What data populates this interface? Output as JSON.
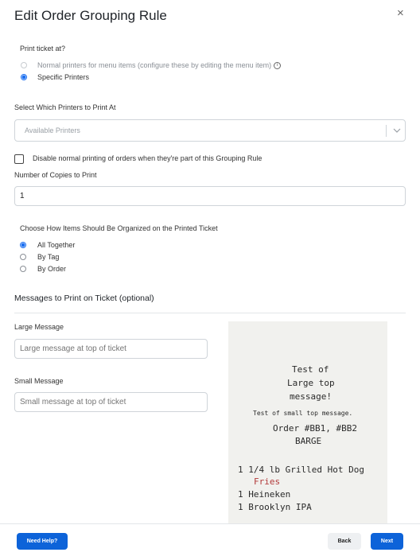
{
  "dialog": {
    "title": "Edit Order Grouping Rule",
    "close_glyph": "×"
  },
  "print_at": {
    "label": "Print ticket at?",
    "options": [
      {
        "label": "Normal printers for menu items (configure these by editing the menu item)",
        "selected": false,
        "disabled": true
      },
      {
        "label": "Specific Printers",
        "selected": true,
        "disabled": false
      }
    ],
    "info_glyph": "i"
  },
  "printers": {
    "label": "Select Which Printers to Print At",
    "placeholder": "Available Printers"
  },
  "disable_normal": {
    "label": "Disable normal printing of orders when they're part of this Grouping Rule",
    "checked": false
  },
  "copies": {
    "label": "Number of Copies to Print",
    "value": "1"
  },
  "organize": {
    "label": "Choose How Items Should Be Organized on the Printed Ticket",
    "options": [
      {
        "label": "All Together",
        "selected": true
      },
      {
        "label": "By Tag",
        "selected": false
      },
      {
        "label": "By Order",
        "selected": false
      }
    ]
  },
  "messages": {
    "title": "Messages to Print on Ticket (optional)",
    "large": {
      "label": "Large Message",
      "placeholder": "Large message at top of ticket"
    },
    "small": {
      "label": "Small Message",
      "placeholder": "Small message at top of ticket"
    }
  },
  "receipt": {
    "large_lines": [
      "Test of",
      "Large top",
      "message!"
    ],
    "small_line": "Test of small top message.",
    "order_line": "Order #BB1, #BB2",
    "location": "BARGE",
    "items": [
      {
        "text": "1 1/4 lb Grilled Hot Dog",
        "color": "#2a2a2a"
      },
      {
        "text": "Fries",
        "color": "#b23a3a"
      },
      {
        "text": "1 Heineken",
        "color": "#2a2a2a"
      },
      {
        "text": "1 Brooklyn IPA",
        "color": "#2a2a2a"
      }
    ]
  },
  "footer": {
    "help_label": "Need Help?",
    "back_label": "Back",
    "next_label": "Next"
  },
  "colors": {
    "primary": "#0d63d9",
    "radio_selected": "#1a6ef0"
  }
}
